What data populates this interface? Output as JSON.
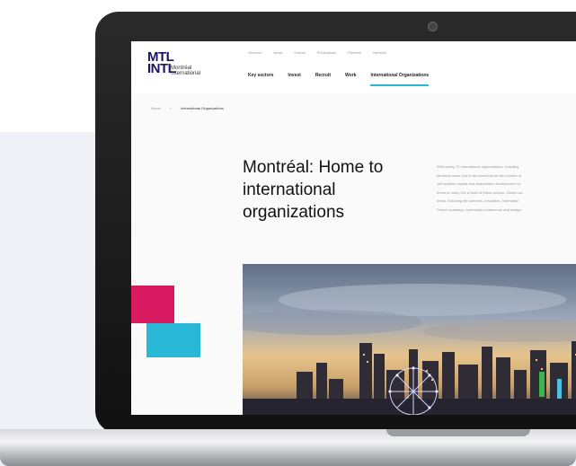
{
  "logo": {
    "mark_line1": "MTL",
    "mark_line2": "INTL",
    "text": "Montréal International"
  },
  "utility_nav": [
    "Services",
    "News",
    "Events",
    "Publications",
    "Partners",
    "Network"
  ],
  "main_nav": [
    {
      "label": "Key sectors",
      "active": false
    },
    {
      "label": "Invest",
      "active": false
    },
    {
      "label": "Recruit",
      "active": false
    },
    {
      "label": "Work",
      "active": false
    },
    {
      "label": "International Organizations",
      "active": true
    }
  ],
  "breadcrumb": {
    "home": "Home",
    "separator": ">",
    "current": "International Organizations"
  },
  "hero": {
    "title": "Montréal: Home to international organizations",
    "intro_lines": [
      "With nearly 70 international organizations, including",
      "Montréal ranks 2nd in the Americas for the number of",
      "civil aviation capital and sustainable development hu",
      "home to many IOs in both of these sectors. Others wo",
      "areas, including life sciences, education, internation",
      "French speaking, community endeavours and design."
    ]
  },
  "colors": {
    "accent_pink": "#d81b60",
    "accent_cyan": "#28b7d4",
    "brand_navy": "#1b1464"
  }
}
